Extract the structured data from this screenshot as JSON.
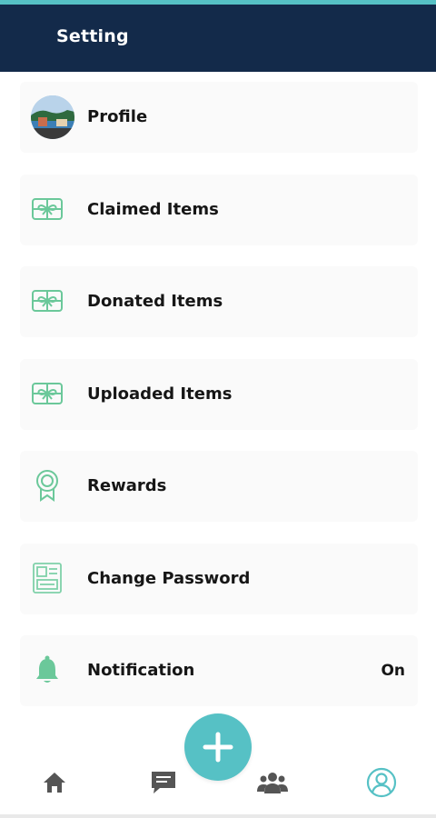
{
  "colors": {
    "header_bg": "#132a4a",
    "accent": "#56c1c5",
    "icon_green": "#6bc89a",
    "nav_gray": "#555555",
    "nav_active": "#56c1c5"
  },
  "header": {
    "title": "Setting"
  },
  "menu": {
    "items": [
      {
        "label": "Profile",
        "icon": "profile-avatar"
      },
      {
        "label": "Claimed Items",
        "icon": "gift-icon"
      },
      {
        "label": "Donated Items",
        "icon": "gift-icon"
      },
      {
        "label": "Uploaded Items",
        "icon": "gift-icon"
      },
      {
        "label": "Rewards",
        "icon": "award-badge-icon"
      },
      {
        "label": "Change Password",
        "icon": "password-card-icon"
      },
      {
        "label": "Notification",
        "icon": "bell-icon",
        "value": "On"
      }
    ]
  },
  "bottom_nav": {
    "items": [
      {
        "icon": "home-icon"
      },
      {
        "icon": "chat-icon"
      },
      {
        "icon": "add-icon"
      },
      {
        "icon": "group-icon"
      },
      {
        "icon": "user-profile-icon",
        "active": true
      }
    ]
  }
}
